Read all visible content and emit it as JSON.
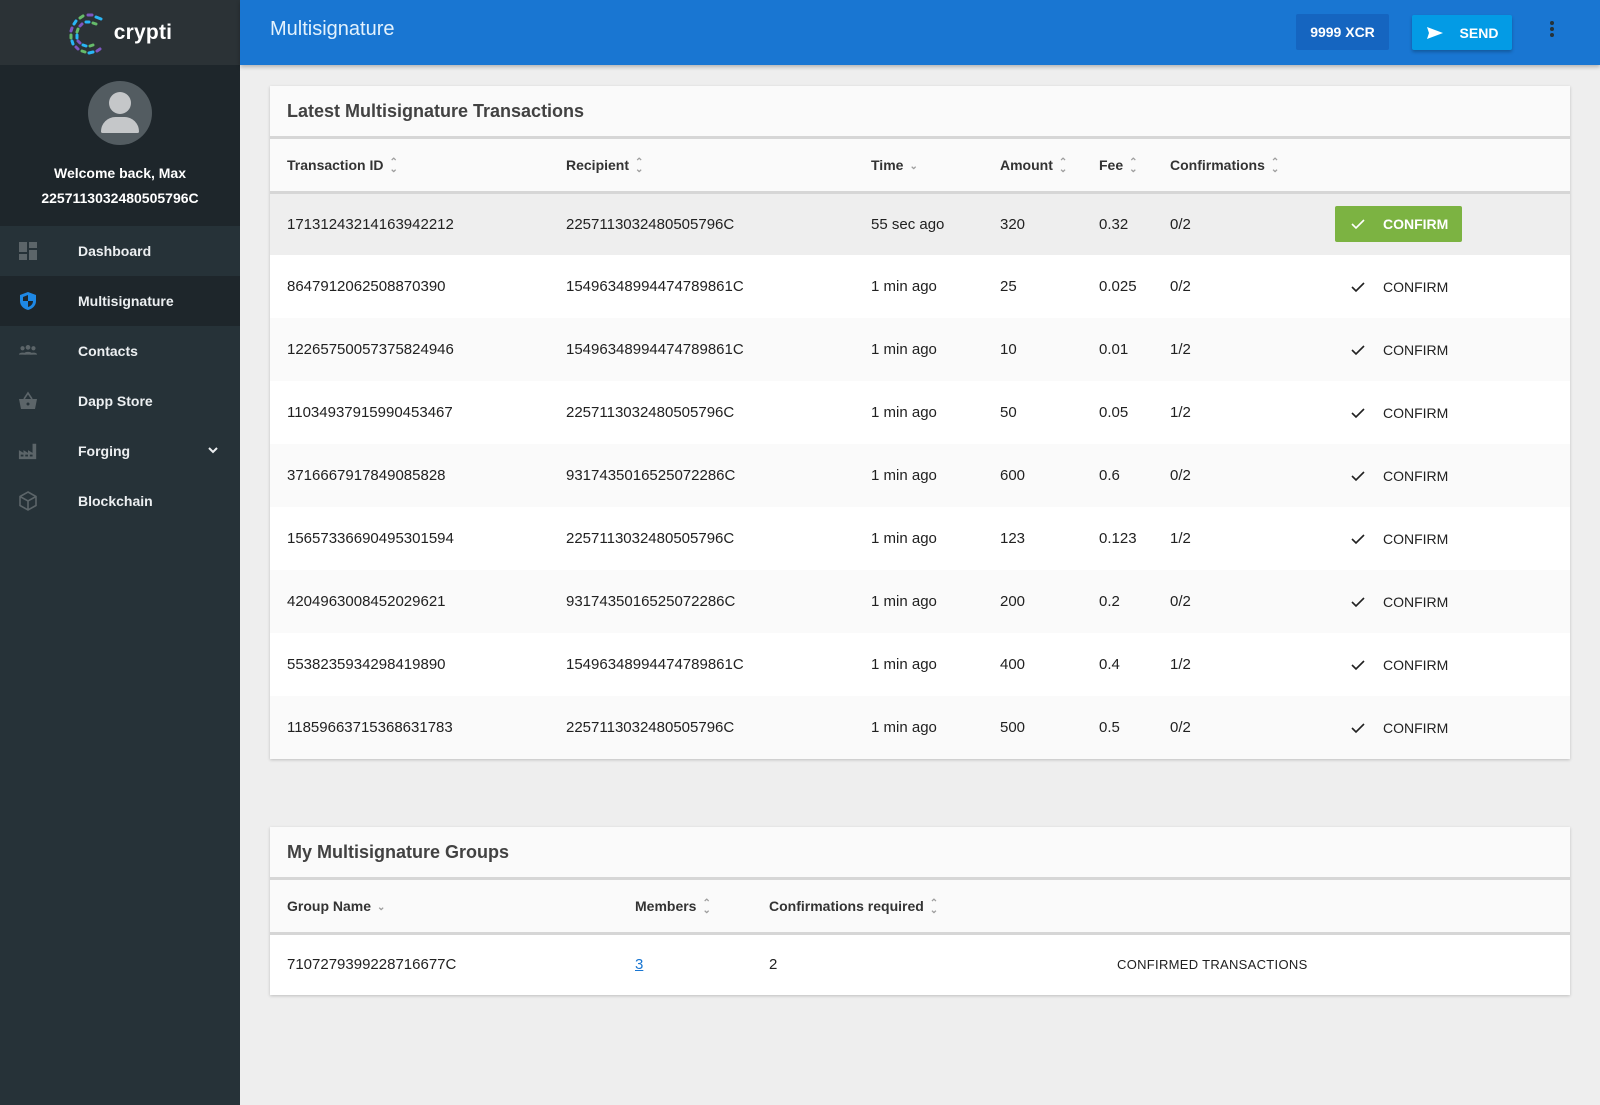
{
  "brand": {
    "name": "crypti"
  },
  "profile": {
    "welcome": "Welcome back, Max",
    "address": "2257113032480505796C"
  },
  "sidebar": {
    "items": [
      {
        "label": "Dashboard",
        "icon": "dashboard-icon",
        "active": false
      },
      {
        "label": "Multisignature",
        "icon": "shield-icon",
        "active": true
      },
      {
        "label": "Contacts",
        "icon": "contacts-icon",
        "active": false
      },
      {
        "label": "Dapp Store",
        "icon": "basket-icon",
        "active": false
      },
      {
        "label": "Forging",
        "icon": "factory-icon",
        "active": false,
        "expandable": true
      },
      {
        "label": "Blockchain",
        "icon": "cube-icon",
        "active": false
      }
    ]
  },
  "header": {
    "title": "Multisignature",
    "balance": "9999 XCR",
    "send_label": "SEND"
  },
  "colors": {
    "primary": "#1976d2",
    "send": "#039be5",
    "confirm": "#7cb342",
    "sidebar": "#263238"
  },
  "transactions": {
    "title": "Latest Multisignature Transactions",
    "columns": [
      "Transaction ID",
      "Recipient",
      "Time",
      "Amount",
      "Fee",
      "Confirmations"
    ],
    "confirm_label": "CONFIRM",
    "rows": [
      {
        "id": "17131243214163942212",
        "recipient": "2257113032480505796C",
        "time": "55 sec ago",
        "amount": "320",
        "fee": "0.32",
        "confirmations": "0/2"
      },
      {
        "id": "8647912062508870390",
        "recipient": "15496348994474789861C",
        "time": "1 min ago",
        "amount": "25",
        "fee": "0.025",
        "confirmations": "0/2"
      },
      {
        "id": "12265750057375824946",
        "recipient": "15496348994474789861C",
        "time": "1 min ago",
        "amount": "10",
        "fee": "0.01",
        "confirmations": "1/2"
      },
      {
        "id": "11034937915990453467",
        "recipient": "2257113032480505796C",
        "time": "1 min ago",
        "amount": "50",
        "fee": "0.05",
        "confirmations": "1/2"
      },
      {
        "id": "3716667917849085828",
        "recipient": "9317435016525072286C",
        "time": "1 min ago",
        "amount": "600",
        "fee": "0.6",
        "confirmations": "0/2"
      },
      {
        "id": "15657336690495301594",
        "recipient": "2257113032480505796C",
        "time": "1 min ago",
        "amount": "123",
        "fee": "0.123",
        "confirmations": "1/2"
      },
      {
        "id": "4204963008452029621",
        "recipient": "9317435016525072286C",
        "time": "1 min ago",
        "amount": "200",
        "fee": "0.2",
        "confirmations": "0/2"
      },
      {
        "id": "5538235934298419890",
        "recipient": "15496348994474789861C",
        "time": "1 min ago",
        "amount": "400",
        "fee": "0.4",
        "confirmations": "1/2"
      },
      {
        "id": "11859663715368631783",
        "recipient": "2257113032480505796C",
        "time": "1 min ago",
        "amount": "500",
        "fee": "0.5",
        "confirmations": "0/2"
      }
    ]
  },
  "groups": {
    "title": "My Multisignature Groups",
    "columns": [
      "Group Name",
      "Members",
      "Confirmations required"
    ],
    "rows": [
      {
        "name": "7107279399228716677C",
        "members": "3",
        "required": "2",
        "action": "CONFIRMED TRANSACTIONS"
      }
    ]
  }
}
